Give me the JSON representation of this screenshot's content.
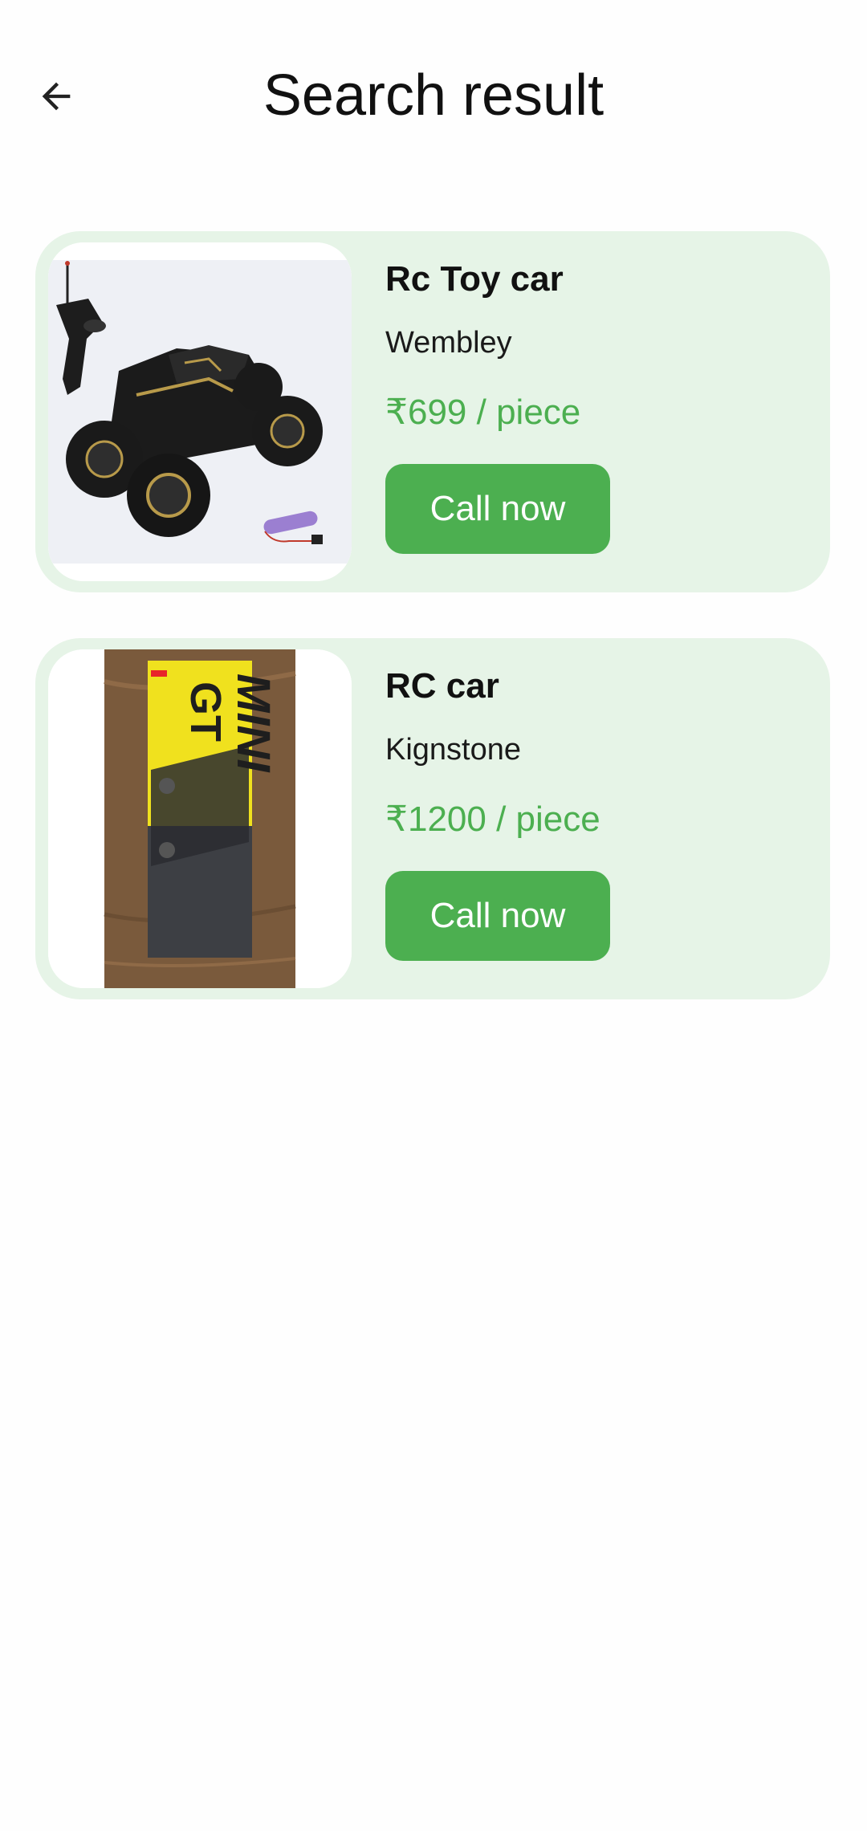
{
  "header": {
    "title": "Search result",
    "back_icon": "arrow-left-icon"
  },
  "colors": {
    "card_background": "#e6f4e7",
    "accent": "#4caf50",
    "button_text": "#ffffff"
  },
  "results": [
    {
      "name": "Rc Toy car",
      "store": "Wembley",
      "price": "₹699 / piece",
      "button_label": "Call now",
      "image": "rc-monster-truck-with-remote-and-battery"
    },
    {
      "name": "RC car",
      "store": "Kignstone",
      "price": "₹1200 / piece",
      "button_label": "Call now",
      "image": "mini-gt-boxed-car-on-wooden-table"
    }
  ]
}
